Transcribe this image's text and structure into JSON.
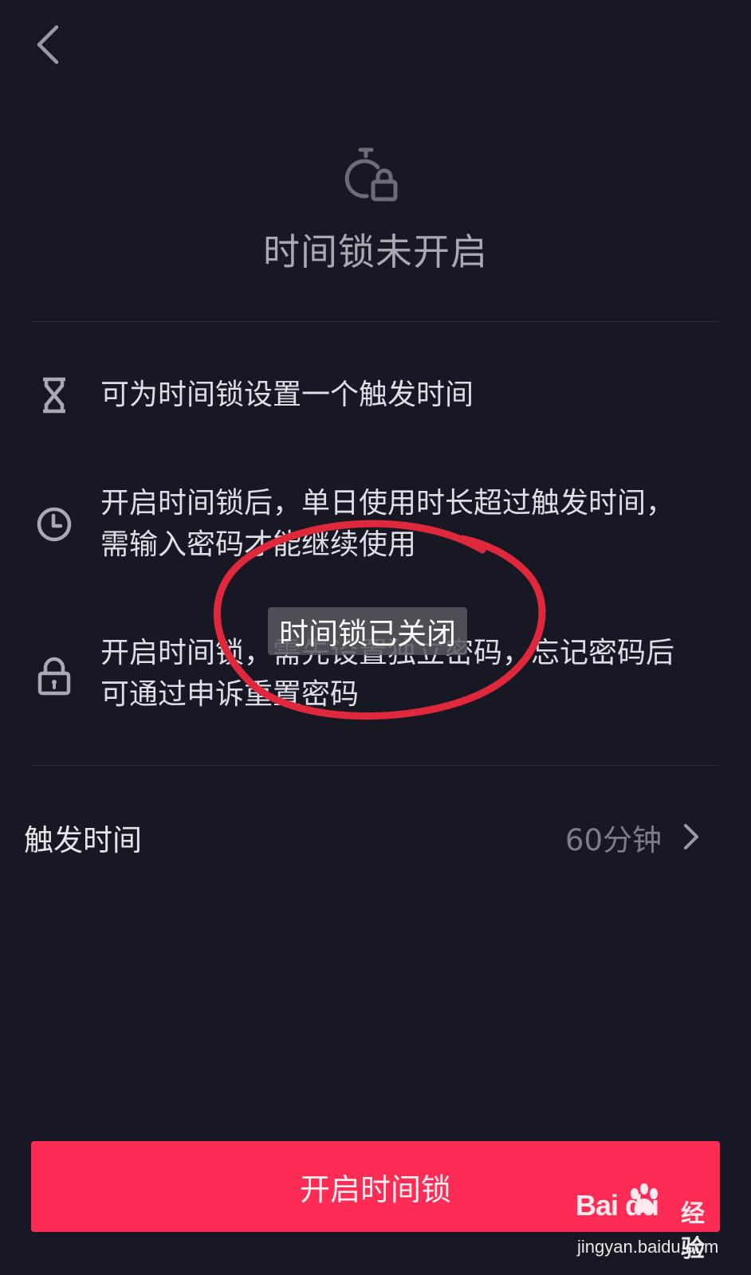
{
  "header": {
    "back_icon": "chevron-left-icon",
    "hero_icon": "stopwatch-lock-icon",
    "title": "时间锁未开启"
  },
  "info_items": [
    {
      "icon": "hourglass-icon",
      "text": "可为时间锁设置一个触发时间"
    },
    {
      "icon": "clock-icon",
      "text": "开启时间锁后，单日使用时长超过触发时间，需输入密码才能继续使用"
    },
    {
      "icon": "lock-icon",
      "text": "开启时间锁，需先设置独立密码，忘记密码后可通过申诉重置密码"
    }
  ],
  "setting": {
    "label": "触发时间",
    "value": "60分钟",
    "icon": "chevron-right-icon"
  },
  "primary_button": {
    "label": "开启时间锁"
  },
  "toast": {
    "text": "时间锁已关闭"
  },
  "watermark": {
    "brand": "Bai du",
    "sub": "经验",
    "url": "jingyan.baidu.com"
  },
  "colors": {
    "background": "#181825",
    "accent": "#fe2c55",
    "annotation": "#e0283c"
  }
}
